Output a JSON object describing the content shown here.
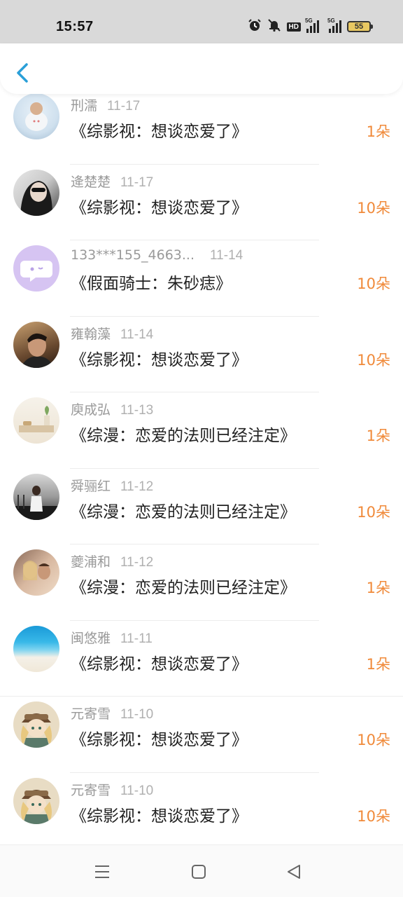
{
  "status_bar": {
    "time": "15:57",
    "battery": "55",
    "hd": "HD",
    "signal1": "5G",
    "signal2": "5G"
  },
  "header": {
    "back_icon": "chevron-left-icon"
  },
  "colors": {
    "accent": "#2a9fd8",
    "count": "#f08a3a"
  },
  "items": [
    {
      "user": "刑濡",
      "date": "11-17",
      "title": "《综影视：想谈恋爱了》",
      "count": "1朵"
    },
    {
      "user": "逄楚楚",
      "date": "11-17",
      "title": "《综影视：想谈恋爱了》",
      "count": "10朵"
    },
    {
      "user": "133***155_4663...",
      "date": "11-14",
      "title": "《假面骑士：朱砂痣》",
      "count": "10朵"
    },
    {
      "user": "雍翰藻",
      "date": "11-14",
      "title": "《综影视：想谈恋爱了》",
      "count": "10朵"
    },
    {
      "user": "庾成弘",
      "date": "11-13",
      "title": "《综漫：恋爱的法则已经注定》",
      "count": "1朵"
    },
    {
      "user": "舜骊红",
      "date": "11-12",
      "title": "《综漫：恋爱的法则已经注定》",
      "count": "10朵"
    },
    {
      "user": "夔浦和",
      "date": "11-12",
      "title": "《综漫：恋爱的法则已经注定》",
      "count": "1朵"
    },
    {
      "user": "闽悠雅",
      "date": "11-11",
      "title": "《综影视：想谈恋爱了》",
      "count": "1朵"
    },
    {
      "user": "元寄雪",
      "date": "11-10",
      "title": "《综影视：想谈恋爱了》",
      "count": "10朵"
    },
    {
      "user": "元寄雪",
      "date": "11-10",
      "title": "《综影视：想谈恋爱了》",
      "count": "10朵"
    }
  ],
  "nav": {
    "menu_icon": "menu-icon",
    "home_icon": "home-square-icon",
    "back_icon": "back-triangle-icon"
  }
}
